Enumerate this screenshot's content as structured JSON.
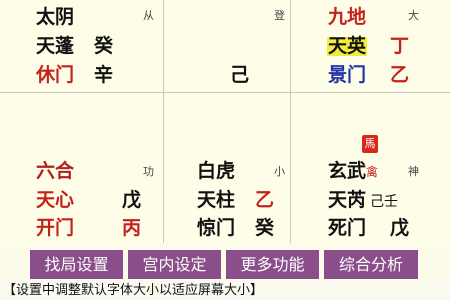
{
  "palace": {
    "top_left": {
      "deity": "太阴",
      "aux": "从",
      "star": "天蓬",
      "star_stem": "癸",
      "door": "休门",
      "door_stem": "辛"
    },
    "top_center": {
      "aux": "登",
      "stem": "己"
    },
    "top_right": {
      "deity": "九地",
      "aux": "大",
      "star": "天英",
      "star_stem": "丁",
      "door": "景门",
      "door_stem": "乙"
    },
    "bottom_left": {
      "deity": "六合",
      "aux": "功",
      "star": "天心",
      "star_stem": "戊",
      "door": "开门",
      "door_stem": "丙"
    },
    "bottom_center": {
      "deity": "白虎",
      "aux": "小",
      "star": "天柱",
      "star_stem": "乙",
      "door": "惊门",
      "door_stem": "癸"
    },
    "bottom_right": {
      "deity": "玄武",
      "deity_mark": "禽",
      "aux": "神",
      "horse": "馬",
      "star": "天芮",
      "star_stems": "己壬",
      "door": "死门",
      "door_stem": "戊"
    }
  },
  "buttons": [
    "找局设置",
    "宫内设定",
    "更多功能",
    "综合分析"
  ],
  "status_text": "【设置中调整默认字体大小以适应屏幕大小】",
  "colors": {
    "button_bg": "#8a4f8a",
    "red_text": "#c4221c",
    "blue_text": "#2233a6",
    "highlight": "#f2ec3e"
  }
}
